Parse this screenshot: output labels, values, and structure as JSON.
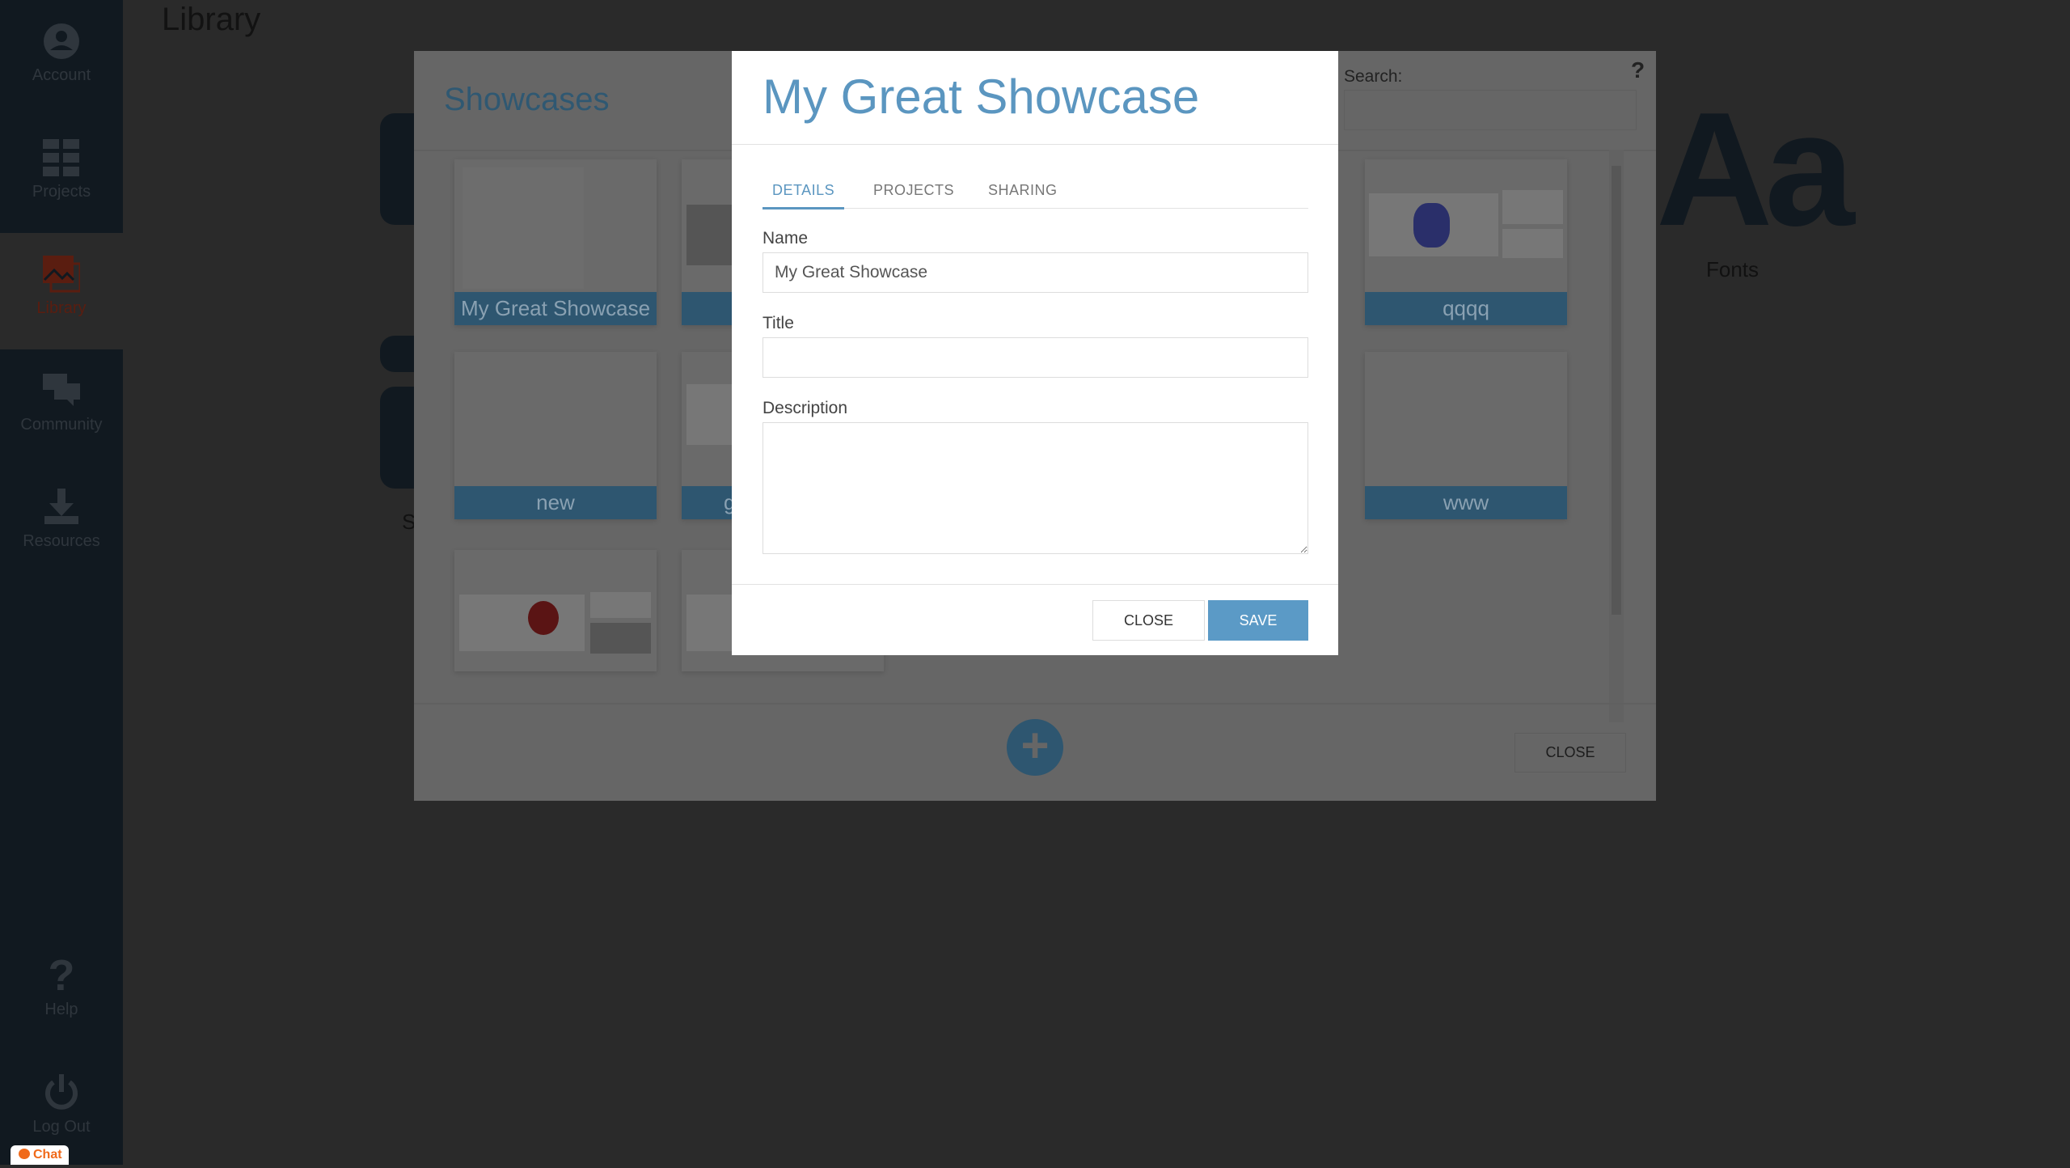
{
  "sidebar": {
    "items": [
      {
        "label": "Account",
        "icon": "account-icon"
      },
      {
        "label": "Projects",
        "icon": "grid-icon"
      },
      {
        "label": "Library",
        "icon": "image-stack-icon",
        "active": true
      },
      {
        "label": "Community",
        "icon": "chat-bubbles-icon"
      },
      {
        "label": "Resources",
        "icon": "download-icon"
      },
      {
        "label": "Help",
        "icon": "question-icon"
      },
      {
        "label": "Log Out",
        "icon": "power-icon"
      }
    ]
  },
  "page": {
    "title": "Library",
    "fonts_glyph": "Aa",
    "fonts_label": "Fonts",
    "partial_label": "S"
  },
  "showcases": {
    "title": "Showcases",
    "search_label": "Search:",
    "search_value": "",
    "help": "?",
    "close": "CLOSE",
    "add": "+",
    "cards": [
      "My Great Showcase",
      "",
      "qqqq",
      "new",
      "g",
      "www",
      "",
      ""
    ]
  },
  "modal": {
    "title": "My Great Showcase",
    "tabs": [
      "DETAILS",
      "PROJECTS",
      "SHARING"
    ],
    "active_tab": "DETAILS",
    "name_label": "Name",
    "name_value": "My Great Showcase",
    "title_label": "Title",
    "title_value": "",
    "description_label": "Description",
    "description_value": "",
    "close": "CLOSE",
    "save": "SAVE",
    "accent": "#5b9ac6"
  },
  "chat": {
    "label": "Chat"
  }
}
